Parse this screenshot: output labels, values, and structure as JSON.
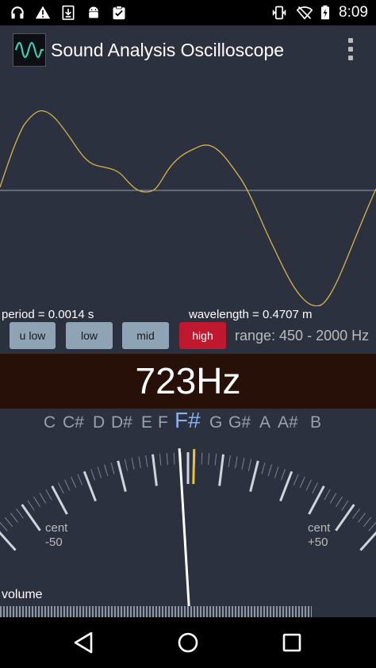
{
  "status_bar": {
    "time": "8:09",
    "icons_left": [
      "headphones-icon",
      "warning-icon",
      "download-icon",
      "android-icon",
      "clipboard-check-icon"
    ],
    "icons_right": [
      "vibrate-icon",
      "wifi-off-icon",
      "battery-charging-icon"
    ]
  },
  "app_bar": {
    "title": "Sound Analysis Oscilloscope",
    "logo_icon": "waveform-icon",
    "menu_icon": "overflow-menu-icon"
  },
  "oscilloscope": {
    "trace_color": "#d9b34a",
    "axis_color": "#9aa0ad",
    "period_label": "period = 0.0014 s",
    "wavelength_label": "wavelength = 0.4707 m"
  },
  "range_buttons": {
    "u_low": "u low",
    "low": "low",
    "mid": "mid",
    "high": "high",
    "selected": "high"
  },
  "range_label": "range: 450 - 2000 Hz",
  "frequency": {
    "value": "723Hz"
  },
  "tuner": {
    "notes": [
      "C",
      "C#",
      "D",
      "D#",
      "E",
      "F",
      "F#",
      "G",
      "G#",
      "A",
      "A#",
      "B"
    ],
    "active_note": "F#",
    "cent_left_top": "cent",
    "cent_left_bottom": "-50",
    "cent_right_top": "cent",
    "cent_right_bottom": "+50",
    "needle_cents": -2,
    "target_marker_color": "#f0c030"
  },
  "volume": {
    "label": "volume",
    "level": 0.83
  },
  "nav_bar": {
    "back_icon": "back-icon",
    "home_icon": "home-icon",
    "recents_icon": "recents-icon"
  }
}
